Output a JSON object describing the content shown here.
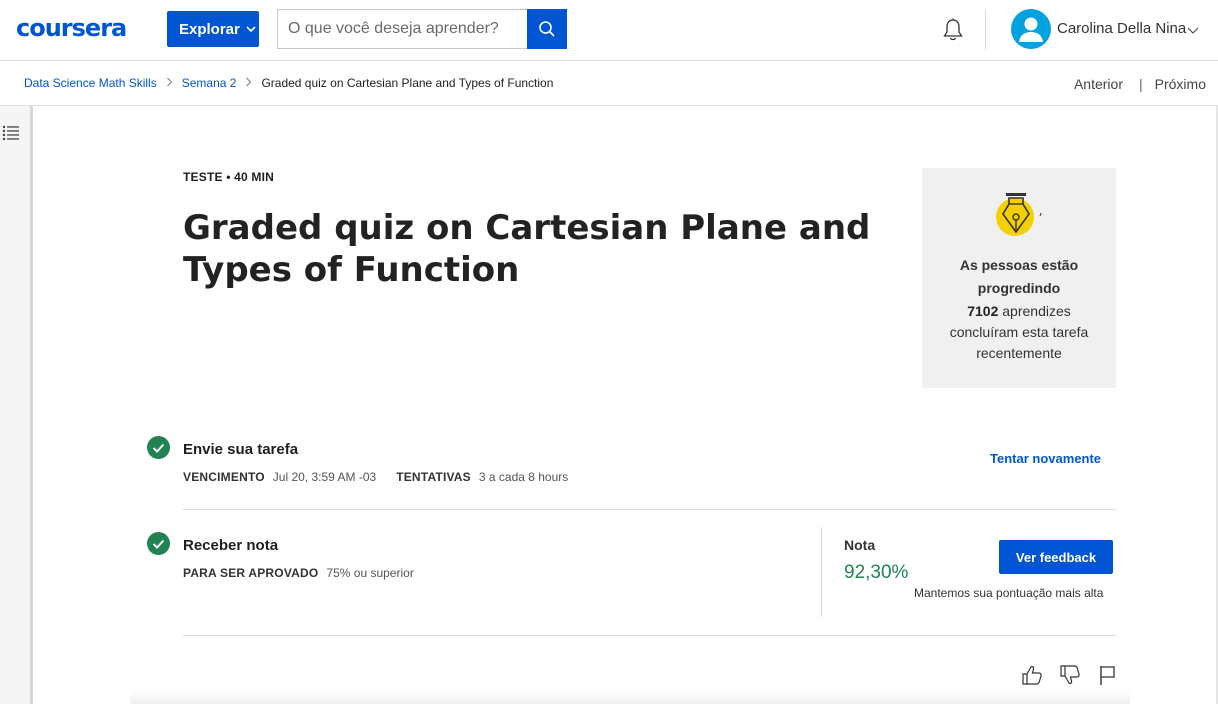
{
  "header": {
    "logo_text": "coursera",
    "explore_label": "Explorar",
    "search_placeholder": "O que você deseja aprender?",
    "user_name": "Carolina Della Nina"
  },
  "breadcrumb": {
    "items": [
      "Data Science Math Skills",
      "Semana 2"
    ],
    "current": "Graded quiz on Cartesian Plane and Types of Function"
  },
  "nav": {
    "previous": "Anterior",
    "next": "Próximo"
  },
  "quiz": {
    "meta": "TESTE • 40 MIN",
    "title": "Graded quiz on Cartesian Plane and Types of Function"
  },
  "progress_card": {
    "heading": "As pessoas estão progredindo",
    "count": "7102",
    "text": "aprendizes concluíram esta tarefa recentemente"
  },
  "submit_step": {
    "title": "Envie sua tarefa",
    "due_label": "VENCIMENTO",
    "due_value": "Jul 20, 3:59 AM -03",
    "attempts_label": "TENTATIVAS",
    "attempts_value": "3 a cada 8 hours",
    "retry_label": "Tentar novamente"
  },
  "grade_step": {
    "title": "Receber nota",
    "pass_label": "PARA SER APROVADO",
    "pass_value": "75% ou superior",
    "grade_label": "Nota",
    "grade_value": "92,30%",
    "feedback_button": "Ver feedback",
    "note": "Mantemos sua pontuação mais alta"
  },
  "colors": {
    "brand_blue": "#0056d2",
    "success_green": "#1f8354",
    "avatar_blue": "#00a3e0",
    "pen_yellow": "#f5d000"
  },
  "icons": [
    "search-icon",
    "bell-icon",
    "user-avatar-icon",
    "chevron-down-icon",
    "list-icon",
    "pen-icon",
    "check-icon",
    "thumbs-up-icon",
    "thumbs-down-icon",
    "flag-icon"
  ]
}
